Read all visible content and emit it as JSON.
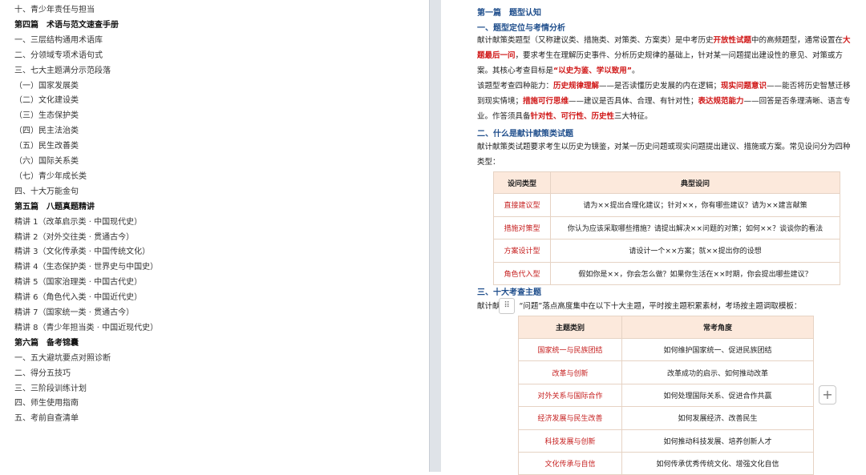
{
  "toc": [
    {
      "text": "十、青少年责任与担当",
      "head": false
    },
    {
      "text": "第四篇　术语与范文速查手册",
      "head": true
    },
    {
      "text": "一、三层结构通用术语库",
      "head": false
    },
    {
      "text": "二、分领域专项术语句式",
      "head": false
    },
    {
      "text": "三、七大主题满分示范段落",
      "head": false
    },
    {
      "text": "（一）国家发展类",
      "head": false
    },
    {
      "text": "（二）文化建设类",
      "head": false
    },
    {
      "text": "（三）生态保护类",
      "head": false
    },
    {
      "text": "（四）民主法治类",
      "head": false
    },
    {
      "text": "（五）民生改善类",
      "head": false
    },
    {
      "text": "（六）国际关系类",
      "head": false
    },
    {
      "text": "（七）青少年成长类",
      "head": false
    },
    {
      "text": "四、十大万能金句",
      "head": false
    },
    {
      "text": "第五篇　八题真题精讲",
      "head": true
    },
    {
      "text": "精讲 1（改革启示类 · 中国现代史）",
      "head": false
    },
    {
      "text": "精讲 2（对外交往类 · 贯通古今）",
      "head": false
    },
    {
      "text": "精讲 3（文化传承类 · 中国传统文化）",
      "head": false
    },
    {
      "text": "精讲 4（生态保护类 · 世界史与中国史）",
      "head": false
    },
    {
      "text": "精讲 5（国家治理类 · 中国古代史）",
      "head": false
    },
    {
      "text": "精讲 6（角色代入类 · 中国近代史）",
      "head": false
    },
    {
      "text": "精讲 7（国家统一类 · 贯通古今）",
      "head": false
    },
    {
      "text": "精讲 8（青少年担当类 · 中国近现代史）",
      "head": false
    },
    {
      "text": "第六篇　备考锦囊",
      "head": true
    },
    {
      "text": "一、五大避坑要点对照诊断",
      "head": false
    },
    {
      "text": "二、得分五技巧",
      "head": false
    },
    {
      "text": "三、三阶段训练计划",
      "head": false
    },
    {
      "text": "四、师生使用指南",
      "head": false
    },
    {
      "text": "五、考前自查清单",
      "head": false
    }
  ],
  "doc": {
    "part_title": "第一篇　题型认知",
    "s1_title": "一、题型定位与考情分析",
    "p1a": "献计献策类题型（又称建议类、措施类、对策类、方案类）是中考历史",
    "p1b": "开放性试题",
    "p1c": "中的高频题型，通常设置在",
    "p1d": "大题最后一问",
    "p1e": "，要求考生在理解历史事件、分析历史规律的基础上，针对某一问题提出建设性的意见、对策或方案。其核心考查目标是",
    "p1f": "“以史为鉴、学以致用”",
    "p1g": "。",
    "p2a": "该题型考查四种能力：",
    "p2b": "历史规律理解",
    "p2c": "——是否读懂历史发展的内在逻辑；",
    "p2d": "现实问题意识",
    "p2e": "——能否将历史智慧迁移到现实情境；",
    "p2f": "措施可行思维",
    "p2g": "——建议是否具体、合理、有针对性；",
    "p2h": "表达规范能力",
    "p2i": "——回答是否条理清晰、语言专业。作答须具备",
    "p2j": "针对性、可行性、历史性",
    "p2k": "三大特征。",
    "s2_title": "二、什么是献计献策类试题",
    "p3": "献计献策类试题要求考生以历史为镜鉴，对某一历史问题或现实问题提出建议、措施或方案。常见设问分为四种类型：",
    "s3_title": "三、十大考查主题",
    "p4a": "献计献",
    "p4b": "“问题”落点高度集中在以下十大主题，平时按主题积累素材，考场按主题调取模板："
  },
  "table1": {
    "headers": [
      "设问类型",
      "典型设问"
    ],
    "rows": [
      [
        "直接建议型",
        "请为××提出合理化建议；针对××，你有哪些建议？请为××建言献策"
      ],
      [
        "措施对策型",
        "你认为应该采取哪些措施？请提出解决××问题的对策；如何××？谈谈你的看法"
      ],
      [
        "方案设计型",
        "请设计一个××方案；就××提出你的设想"
      ],
      [
        "角色代入型",
        "假如你是××，你会怎么做？如果你生活在××时期，你会提出哪些建议？"
      ]
    ]
  },
  "table2": {
    "headers": [
      "主题类别",
      "常考角度"
    ],
    "rows": [
      [
        "国家统一与民族团结",
        "如何维护国家统一、促进民族团结"
      ],
      [
        "改革与创新",
        "改革成功的启示、如何推动改革"
      ],
      [
        "对外关系与国际合作",
        "如何处理国际关系、促进合作共赢"
      ],
      [
        "经济发展与民生改善",
        "如何发展经济、改善民生"
      ],
      [
        "科技发展与创新",
        "如何推动科技发展、培养创新人才"
      ],
      [
        "文化传承与自信",
        "如何传承优秀传统文化、增强文化自信"
      ]
    ]
  },
  "icons": {
    "handle": "⠿",
    "plus": "+"
  }
}
